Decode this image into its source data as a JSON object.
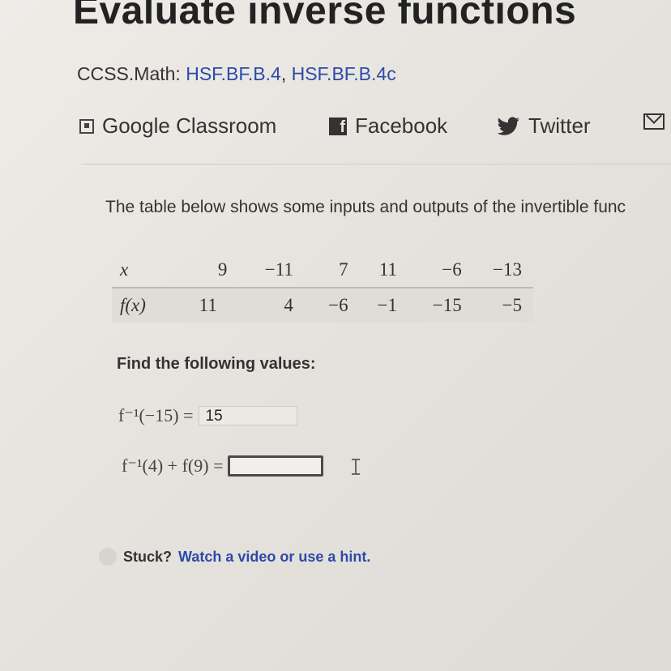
{
  "header": {
    "title": "Evaluate inverse functions",
    "ccss_label": "CCSS.Math:",
    "ccss_link1": "HSF.BF.B.4",
    "ccss_sep": ",",
    "ccss_link2": "HSF.BF.B.4c"
  },
  "share": {
    "google_classroom": "Google Classroom",
    "facebook": "Facebook",
    "twitter": "Twitter"
  },
  "problem": {
    "prompt": "The table below shows some inputs and outputs of the invertible func",
    "table": {
      "x_label": "x",
      "fx_label": "f(x)",
      "x": [
        "9",
        "−11",
        "7",
        "11",
        "−6",
        "−13"
      ],
      "fx": [
        "11",
        "4",
        "−6",
        "−1",
        "−15",
        "−5"
      ]
    },
    "find_label": "Find the following values:",
    "q1_expr": "f⁻¹(−15) =",
    "q1_value": "15",
    "q2_expr": "f⁻¹(4) + f(9) =",
    "q2_value": ""
  },
  "help": {
    "stuck": "Stuck?",
    "link": "Watch a video or use a hint."
  }
}
